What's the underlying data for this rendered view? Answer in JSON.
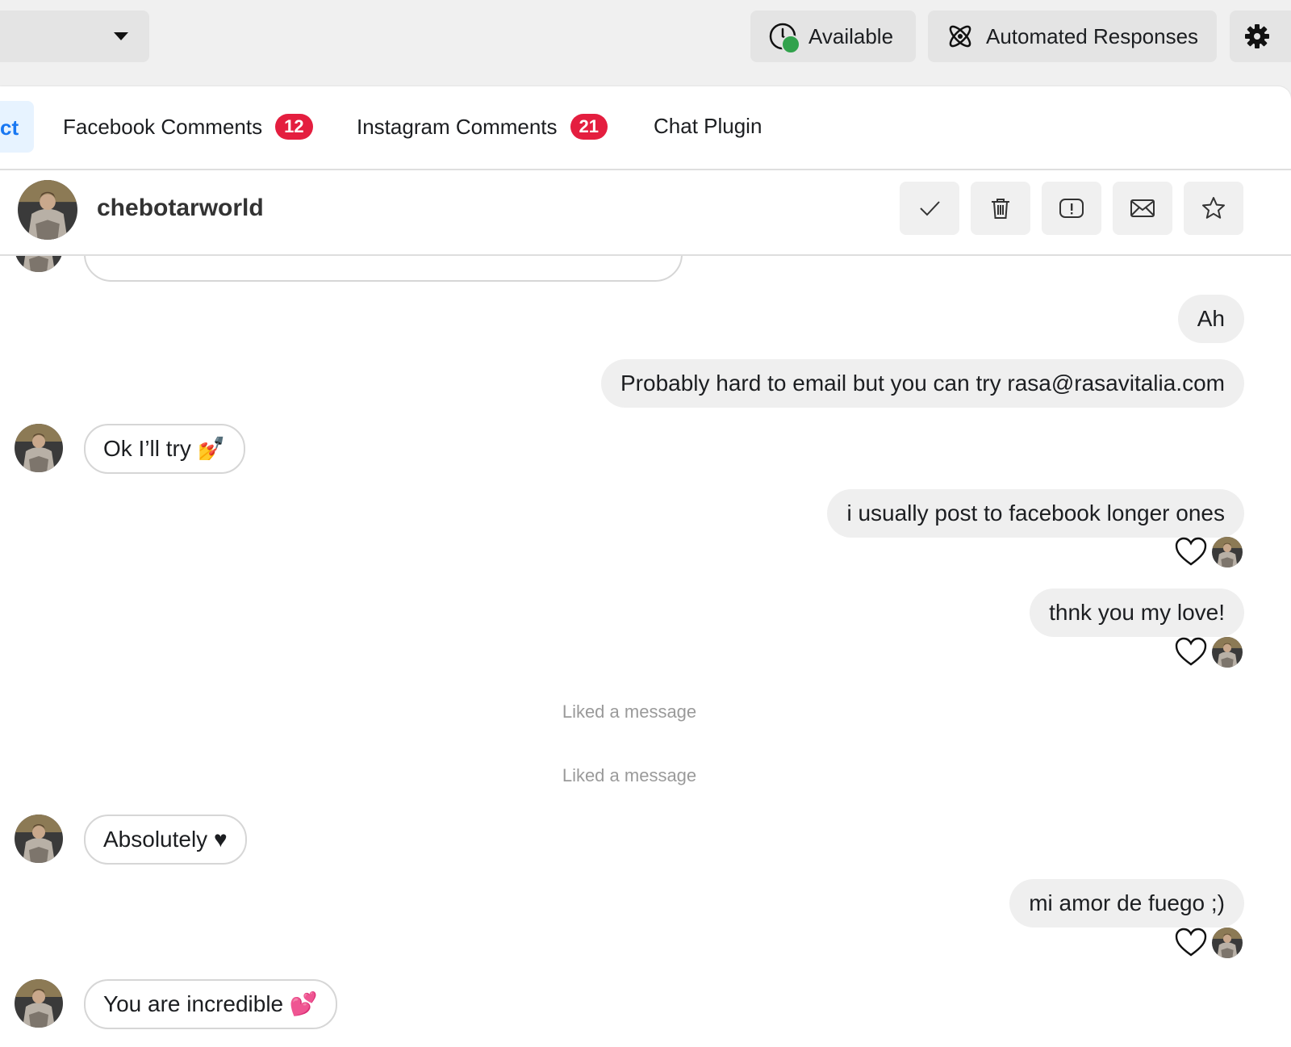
{
  "topbar": {
    "available_label": "Available",
    "automated_label": "Automated Responses"
  },
  "tabs": {
    "active_partial": "ct",
    "facebook_label": "Facebook Comments",
    "facebook_count": "12",
    "instagram_label": "Instagram Comments",
    "instagram_count": "21",
    "chat_label": "Chat Plugin"
  },
  "conversation": {
    "username": "chebotarworld",
    "actions": [
      "check-icon",
      "trash-icon",
      "alert-icon",
      "mail-icon",
      "star-icon"
    ]
  },
  "messages": {
    "m1": "Ah",
    "m2": "Probably hard to email but you can try rasa@rasavitalia.com",
    "m3": "Ok I’ll try 💅",
    "m4": "i usually post to facebook longer ones",
    "m5": "thnk you my love!",
    "sys1": "Liked a message",
    "sys2": "Liked a message",
    "m6": "Absolutely ♥",
    "m7": "mi amor de fuego ;)",
    "m8": "You are incredible 💕"
  },
  "colors": {
    "accent": "#1877f2",
    "badge": "#e41e3f",
    "online": "#31a24c"
  }
}
